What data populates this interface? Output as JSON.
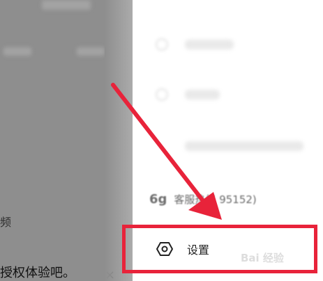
{
  "background_app": {
    "snippet_1": "频",
    "bottom_text": "授权体验吧。",
    "close_symbol": "×"
  },
  "drawer": {
    "service_item": {
      "icon": "6g",
      "label": "客服热线 95152)"
    },
    "settings_item": {
      "icon_name": "hexagon-settings-icon",
      "label": "设置"
    }
  },
  "annotation": {
    "watermark": "Bai 经验",
    "arrow_color": "#e8233a",
    "box_color": "#e8233a"
  }
}
